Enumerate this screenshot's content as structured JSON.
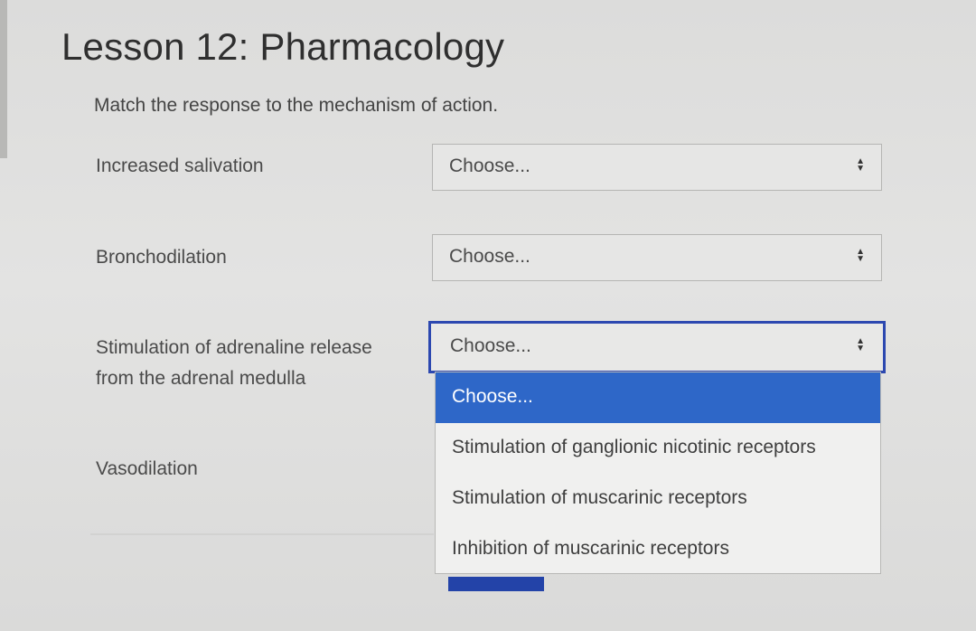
{
  "title": "Lesson 12: Pharmacology",
  "instruction": "Match the response to the mechanism of action.",
  "questions": [
    {
      "label": "Increased salivation",
      "selected": "Choose..."
    },
    {
      "label": "Bronchodilation",
      "selected": "Choose..."
    },
    {
      "label_line1": "Stimulation of adrenaline release",
      "label_line2": "from the adrenal medulla",
      "selected": "Choose..."
    },
    {
      "label": "Vasodilation"
    }
  ],
  "dropdown": {
    "options": [
      "Choose...",
      "Stimulation of ganglionic nicotinic receptors",
      "Stimulation of muscarinic receptors",
      "Inhibition of muscarinic receptors"
    ]
  },
  "icons": {
    "select_arrows": "up-down-chevron-icon"
  },
  "colors": {
    "accent": "#2e67c8",
    "focus_border": "#2c48b0"
  }
}
